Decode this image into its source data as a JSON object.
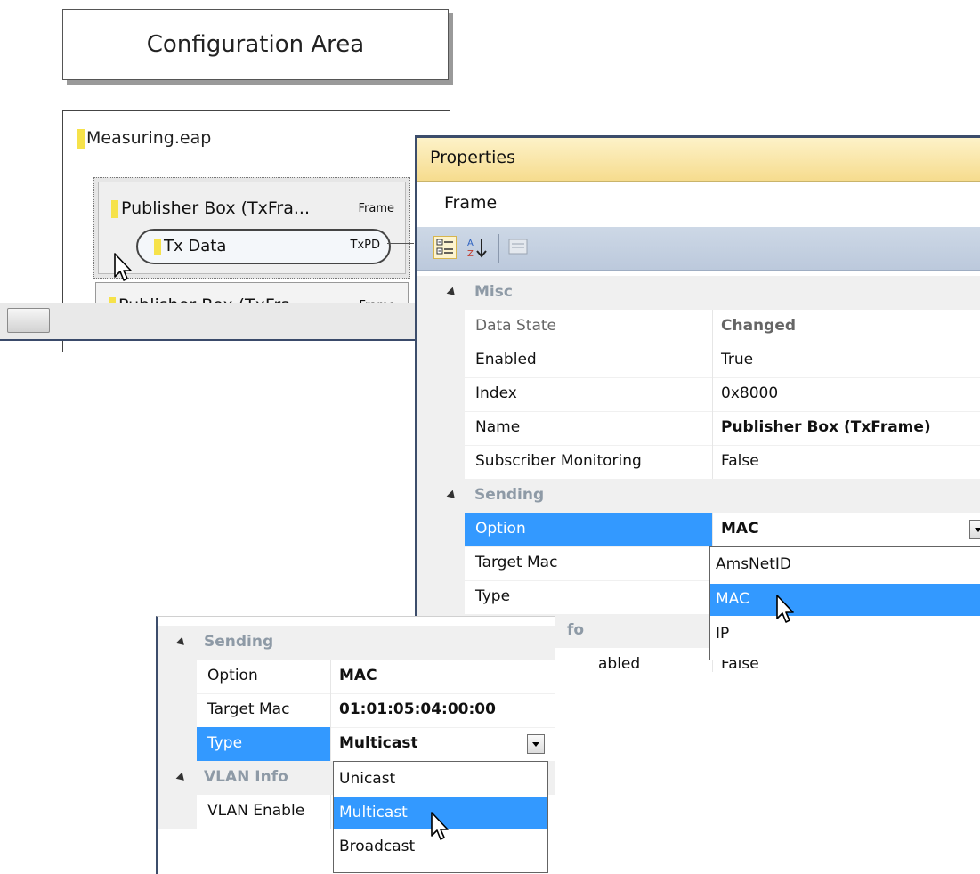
{
  "config_area": {
    "label": "Configuration Area"
  },
  "designer": {
    "project_name": "Measuring.eap",
    "publisher_box": {
      "label": "Publisher  Box (TxFra...",
      "kind": "Frame"
    },
    "tx_data": {
      "label": "Tx Data",
      "kind": "TxPD"
    },
    "publisher_box2": {
      "label": "Publisher Box (TxFra...",
      "kind": "Frame"
    }
  },
  "properties": {
    "title": "Properties",
    "object": "Frame",
    "toolbar": {
      "categorized_icon": "categorized-icon",
      "alphabetical_icon": "alphabetical-icon",
      "pages_icon": "property-pages-icon"
    },
    "categories": [
      {
        "name": "Misc",
        "rows": [
          {
            "name": "Data State",
            "value": "Changed"
          },
          {
            "name": "Enabled",
            "value": "True"
          },
          {
            "name": "Index",
            "value": "0x8000"
          },
          {
            "name": "Name",
            "value": "Publisher Box (TxFrame)"
          },
          {
            "name": "Subscriber Monitoring",
            "value": "False"
          }
        ]
      },
      {
        "name": "Sending",
        "rows": [
          {
            "name": "Option",
            "value": "MAC"
          },
          {
            "name": "Target Mac",
            "value": ""
          },
          {
            "name": "Type",
            "value": ""
          }
        ]
      },
      {
        "name": "VLAN Info",
        "visible_fragment": "fo",
        "rows": [
          {
            "name": "VLAN Enabled",
            "visible_fragment": "abled",
            "value": "False"
          }
        ]
      }
    ],
    "option_dropdown": {
      "options": [
        "AmsNetID",
        "MAC",
        "IP"
      ],
      "selected": "MAC"
    }
  },
  "properties2": {
    "categories": [
      {
        "name": "Sending",
        "rows": [
          {
            "name": "Option",
            "value": "MAC"
          },
          {
            "name": "Target Mac",
            "value": "01:01:05:04:00:00"
          },
          {
            "name": "Type",
            "value": "Multicast"
          }
        ]
      },
      {
        "name": "VLAN Info",
        "rows": [
          {
            "name": "VLAN Enabled",
            "visible_fragment": "VLAN Enable"
          }
        ]
      }
    ],
    "type_dropdown": {
      "options": [
        "Unicast",
        "Multicast",
        "Broadcast"
      ],
      "selected": "Multicast"
    }
  },
  "colors": {
    "selection": "#3399ff",
    "title_bar": "#f6dc8e",
    "toolbar": "#c5d1e1",
    "frame_border": "#3c4d6b"
  }
}
